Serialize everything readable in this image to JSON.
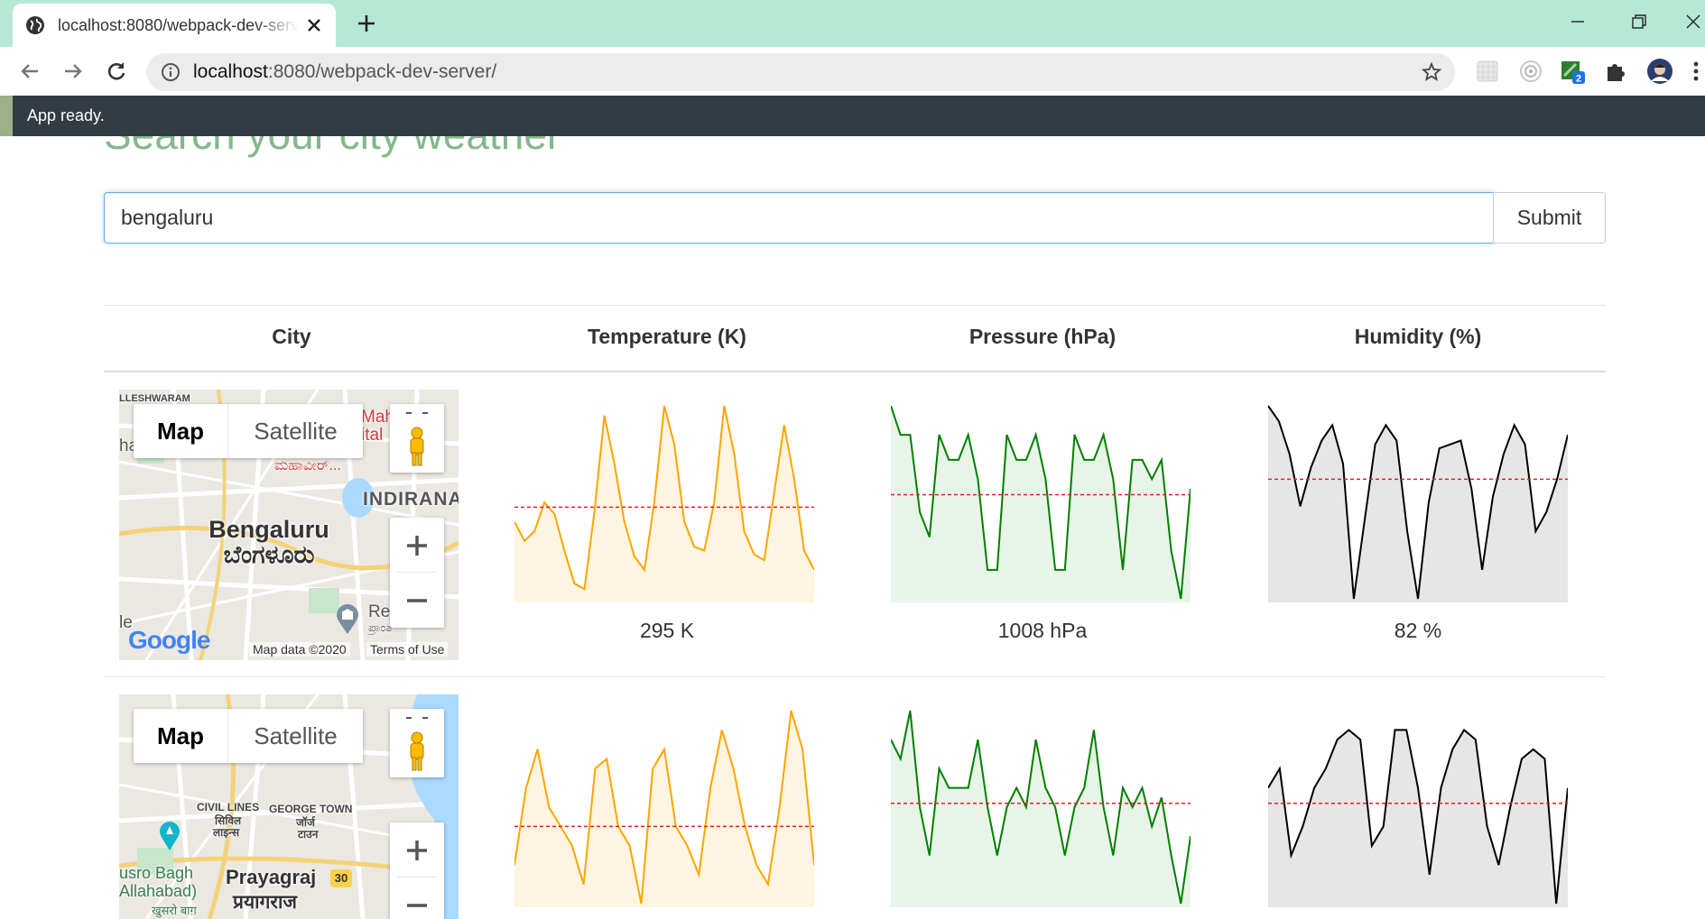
{
  "browser": {
    "tab_title": "localhost:8080/webpack-dev-server/",
    "url_host": "localhost",
    "url_rest": ":8080/webpack-dev-server/",
    "extension_badge": "2"
  },
  "notice": {
    "text": "App ready."
  },
  "page": {
    "title": "Search your city weather",
    "search_value": "bengaluru",
    "submit_label": "Submit"
  },
  "table": {
    "headers": [
      "City",
      "Temperature (K)",
      "Pressure (hPa)",
      "Humidity (%)"
    ]
  },
  "rows": [
    {
      "map": {
        "map_label": "Map",
        "satellite_label": "Satellite",
        "city": "Bengaluru",
        "city_local": "ಬೆಂಗಳೂರು",
        "labels": [
          "LLESHWARAM",
          "Mah",
          "ital",
          "ಮಹಾವೀರ್...",
          "INDIRANA",
          "Re",
          "ಪ್ರಾಂತ",
          "ha",
          "le"
        ],
        "logo": "Google",
        "map_data": "Map data ©2020",
        "terms": "Terms of Use"
      },
      "temperature": {
        "display": "295 K"
      },
      "pressure": {
        "display": "1008 hPa"
      },
      "humidity": {
        "display": "82 %"
      }
    },
    {
      "map": {
        "map_label": "Map",
        "satellite_label": "Satellite",
        "city": "Prayagraj",
        "city_local": "प्रयागराज",
        "labels": [
          "CIVIL LINES",
          "सिविल",
          "लाइन्स",
          "GEORGE TOWN",
          "जॉर्ज",
          "टाउन",
          "usro Bagh",
          "Allahabad)",
          "खुसरो बाग़",
          "30"
        ]
      }
    }
  ],
  "chart_data": [
    {
      "type": "line",
      "title": "Temperature (K)",
      "row": 1,
      "color": "#ffa500",
      "fill": "#fff5e0",
      "values": [
        4,
        3,
        3.5,
        5,
        4.4,
        2.5,
        0.8,
        0.5,
        4.5,
        9.5,
        7,
        4,
        2.2,
        1.5,
        5,
        10,
        8,
        4,
        2.7,
        2.5,
        5,
        10,
        7.5,
        3.5,
        2.3,
        2,
        5.5,
        9,
        6.2,
        2.5,
        1.5
      ],
      "mean": 4.75,
      "ylim": [
        0,
        10
      ]
    },
    {
      "type": "line",
      "title": "Pressure (hPa)",
      "row": 1,
      "color": "#008000",
      "fill": "#e8f4e8",
      "values": [
        10,
        8.5,
        8.5,
        4.5,
        3.2,
        8.5,
        7.2,
        7.2,
        8.5,
        6.2,
        1.5,
        1.5,
        8.5,
        7.2,
        7.2,
        8.5,
        6.2,
        1.5,
        1.5,
        8.5,
        7.2,
        7.2,
        8.5,
        6.2,
        1.5,
        7.2,
        7.2,
        6.2,
        7.2,
        2.5,
        0,
        5.7
      ],
      "mean": 5.4,
      "ylim": [
        0,
        10
      ]
    },
    {
      "type": "line",
      "title": "Humidity (%)",
      "row": 1,
      "color": "#000000",
      "fill": "#e6e6e6",
      "values": [
        10,
        9.2,
        7.5,
        4.8,
        6.8,
        8.2,
        9,
        7,
        0,
        4,
        8,
        9,
        8.2,
        3.5,
        0,
        5,
        7.8,
        8,
        8.2,
        5.7,
        1.5,
        5.3,
        7.5,
        9,
        8,
        3.5,
        4.5,
        6.2,
        8.5
      ],
      "mean": 6.2,
      "ylim": [
        0,
        10
      ]
    },
    {
      "type": "line",
      "title": "Temperature (K)",
      "row": 2,
      "color": "#ffa500",
      "fill": "#fff5e0",
      "values": [
        2,
        6,
        8,
        5,
        4,
        3,
        1,
        7,
        7.5,
        4,
        3,
        0,
        7,
        8,
        4,
        3,
        1.5,
        6,
        9,
        7,
        4,
        2,
        1,
        5,
        10,
        8,
        2
      ],
      "mean": 4,
      "ylim": [
        0,
        10
      ]
    },
    {
      "type": "line",
      "title": "Pressure (hPa)",
      "row": 2,
      "color": "#008000",
      "fill": "#e8f4e8",
      "values": [
        8.5,
        7.5,
        10,
        5,
        2.5,
        7,
        6,
        6,
        6,
        8.5,
        5,
        2.5,
        5,
        6,
        5,
        8.5,
        6,
        5,
        2.5,
        5,
        6,
        9,
        5,
        2.5,
        6,
        5,
        6,
        4,
        5.5,
        2.5,
        0,
        3.5
      ],
      "mean": 5.2,
      "ylim": [
        0,
        10
      ]
    },
    {
      "type": "line",
      "title": "Humidity (%)",
      "row": 2,
      "color": "#000000",
      "fill": "#e6e6e6",
      "values": [
        6,
        7,
        2.5,
        4,
        6,
        7,
        8.5,
        9,
        8.5,
        3,
        4,
        9,
        9,
        6,
        1.5,
        6,
        8,
        9,
        8.5,
        4,
        2,
        5,
        7.5,
        8,
        7.5,
        0,
        6
      ],
      "mean": 5.2,
      "ylim": [
        0,
        10
      ]
    }
  ]
}
